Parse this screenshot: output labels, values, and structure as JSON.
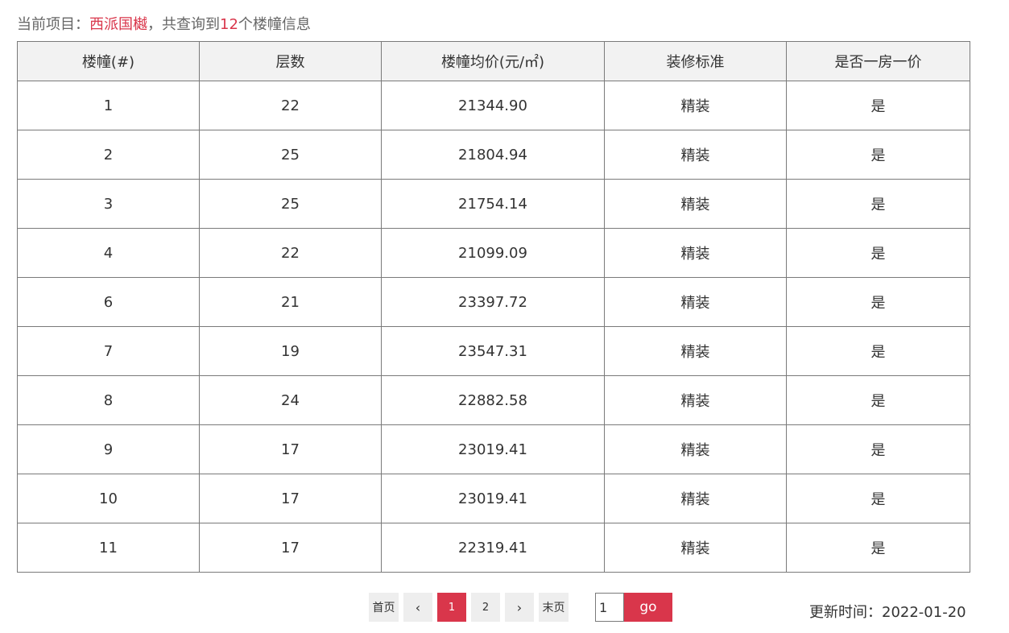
{
  "summary": {
    "prefix": "当前项目：",
    "project_name": "西派国樾",
    "middle": "，共查询到",
    "count": "12",
    "suffix": "个楼幢信息"
  },
  "table": {
    "headers": [
      "楼幢(#)",
      "层数",
      "楼幢均价(元/㎡)",
      "装修标准",
      "是否一房一价"
    ],
    "rows": [
      [
        "1",
        "22",
        "21344.90",
        "精装",
        "是"
      ],
      [
        "2",
        "25",
        "21804.94",
        "精装",
        "是"
      ],
      [
        "3",
        "25",
        "21754.14",
        "精装",
        "是"
      ],
      [
        "4",
        "22",
        "21099.09",
        "精装",
        "是"
      ],
      [
        "6",
        "21",
        "23397.72",
        "精装",
        "是"
      ],
      [
        "7",
        "19",
        "23547.31",
        "精装",
        "是"
      ],
      [
        "8",
        "24",
        "22882.58",
        "精装",
        "是"
      ],
      [
        "9",
        "17",
        "23019.41",
        "精装",
        "是"
      ],
      [
        "10",
        "17",
        "23019.41",
        "精装",
        "是"
      ],
      [
        "11",
        "17",
        "22319.41",
        "精装",
        "是"
      ]
    ]
  },
  "pagination": {
    "first_label": "首页",
    "prev_icon": "‹",
    "pages": [
      "1",
      "2"
    ],
    "active_page": "1",
    "next_icon": "›",
    "last_label": "末页",
    "jump_value": "1",
    "go_label": "go"
  },
  "updated": {
    "label": "更新时间：",
    "date": "2022-01-20"
  },
  "colors": {
    "accent": "#d9364b",
    "header_bg": "#f2f2f2",
    "border": "#7a7a7a",
    "pager_bg": "#eeeeee"
  }
}
